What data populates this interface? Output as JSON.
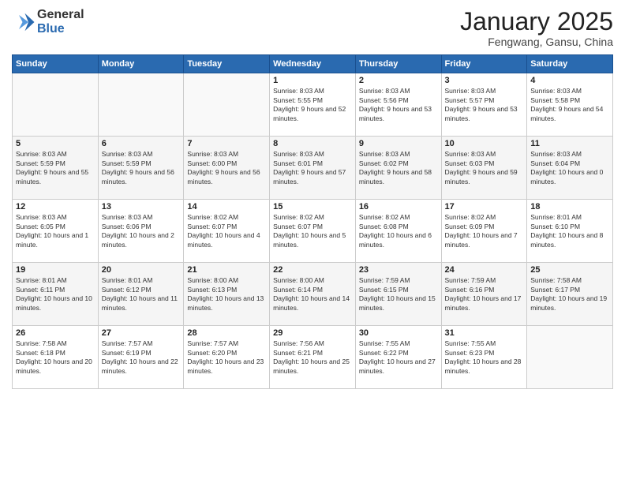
{
  "header": {
    "logo_line1": "General",
    "logo_line2": "Blue",
    "month_title": "January 2025",
    "location": "Fengwang, Gansu, China"
  },
  "days_of_week": [
    "Sunday",
    "Monday",
    "Tuesday",
    "Wednesday",
    "Thursday",
    "Friday",
    "Saturday"
  ],
  "weeks": [
    [
      {
        "day": "",
        "info": ""
      },
      {
        "day": "",
        "info": ""
      },
      {
        "day": "",
        "info": ""
      },
      {
        "day": "1",
        "info": "Sunrise: 8:03 AM\nSunset: 5:55 PM\nDaylight: 9 hours and 52 minutes."
      },
      {
        "day": "2",
        "info": "Sunrise: 8:03 AM\nSunset: 5:56 PM\nDaylight: 9 hours and 53 minutes."
      },
      {
        "day": "3",
        "info": "Sunrise: 8:03 AM\nSunset: 5:57 PM\nDaylight: 9 hours and 53 minutes."
      },
      {
        "day": "4",
        "info": "Sunrise: 8:03 AM\nSunset: 5:58 PM\nDaylight: 9 hours and 54 minutes."
      }
    ],
    [
      {
        "day": "5",
        "info": "Sunrise: 8:03 AM\nSunset: 5:59 PM\nDaylight: 9 hours and 55 minutes."
      },
      {
        "day": "6",
        "info": "Sunrise: 8:03 AM\nSunset: 5:59 PM\nDaylight: 9 hours and 56 minutes."
      },
      {
        "day": "7",
        "info": "Sunrise: 8:03 AM\nSunset: 6:00 PM\nDaylight: 9 hours and 56 minutes."
      },
      {
        "day": "8",
        "info": "Sunrise: 8:03 AM\nSunset: 6:01 PM\nDaylight: 9 hours and 57 minutes."
      },
      {
        "day": "9",
        "info": "Sunrise: 8:03 AM\nSunset: 6:02 PM\nDaylight: 9 hours and 58 minutes."
      },
      {
        "day": "10",
        "info": "Sunrise: 8:03 AM\nSunset: 6:03 PM\nDaylight: 9 hours and 59 minutes."
      },
      {
        "day": "11",
        "info": "Sunrise: 8:03 AM\nSunset: 6:04 PM\nDaylight: 10 hours and 0 minutes."
      }
    ],
    [
      {
        "day": "12",
        "info": "Sunrise: 8:03 AM\nSunset: 6:05 PM\nDaylight: 10 hours and 1 minute."
      },
      {
        "day": "13",
        "info": "Sunrise: 8:03 AM\nSunset: 6:06 PM\nDaylight: 10 hours and 2 minutes."
      },
      {
        "day": "14",
        "info": "Sunrise: 8:02 AM\nSunset: 6:07 PM\nDaylight: 10 hours and 4 minutes."
      },
      {
        "day": "15",
        "info": "Sunrise: 8:02 AM\nSunset: 6:07 PM\nDaylight: 10 hours and 5 minutes."
      },
      {
        "day": "16",
        "info": "Sunrise: 8:02 AM\nSunset: 6:08 PM\nDaylight: 10 hours and 6 minutes."
      },
      {
        "day": "17",
        "info": "Sunrise: 8:02 AM\nSunset: 6:09 PM\nDaylight: 10 hours and 7 minutes."
      },
      {
        "day": "18",
        "info": "Sunrise: 8:01 AM\nSunset: 6:10 PM\nDaylight: 10 hours and 8 minutes."
      }
    ],
    [
      {
        "day": "19",
        "info": "Sunrise: 8:01 AM\nSunset: 6:11 PM\nDaylight: 10 hours and 10 minutes."
      },
      {
        "day": "20",
        "info": "Sunrise: 8:01 AM\nSunset: 6:12 PM\nDaylight: 10 hours and 11 minutes."
      },
      {
        "day": "21",
        "info": "Sunrise: 8:00 AM\nSunset: 6:13 PM\nDaylight: 10 hours and 13 minutes."
      },
      {
        "day": "22",
        "info": "Sunrise: 8:00 AM\nSunset: 6:14 PM\nDaylight: 10 hours and 14 minutes."
      },
      {
        "day": "23",
        "info": "Sunrise: 7:59 AM\nSunset: 6:15 PM\nDaylight: 10 hours and 15 minutes."
      },
      {
        "day": "24",
        "info": "Sunrise: 7:59 AM\nSunset: 6:16 PM\nDaylight: 10 hours and 17 minutes."
      },
      {
        "day": "25",
        "info": "Sunrise: 7:58 AM\nSunset: 6:17 PM\nDaylight: 10 hours and 19 minutes."
      }
    ],
    [
      {
        "day": "26",
        "info": "Sunrise: 7:58 AM\nSunset: 6:18 PM\nDaylight: 10 hours and 20 minutes."
      },
      {
        "day": "27",
        "info": "Sunrise: 7:57 AM\nSunset: 6:19 PM\nDaylight: 10 hours and 22 minutes."
      },
      {
        "day": "28",
        "info": "Sunrise: 7:57 AM\nSunset: 6:20 PM\nDaylight: 10 hours and 23 minutes."
      },
      {
        "day": "29",
        "info": "Sunrise: 7:56 AM\nSunset: 6:21 PM\nDaylight: 10 hours and 25 minutes."
      },
      {
        "day": "30",
        "info": "Sunrise: 7:55 AM\nSunset: 6:22 PM\nDaylight: 10 hours and 27 minutes."
      },
      {
        "day": "31",
        "info": "Sunrise: 7:55 AM\nSunset: 6:23 PM\nDaylight: 10 hours and 28 minutes."
      },
      {
        "day": "",
        "info": ""
      }
    ]
  ]
}
